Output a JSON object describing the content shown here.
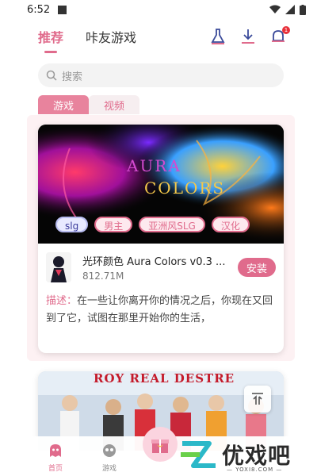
{
  "status": {
    "time": "6:52"
  },
  "topnav": {
    "tabs": [
      {
        "label": "推荐",
        "active": true
      },
      {
        "label": "咔友游戏",
        "active": false
      }
    ],
    "icons": [
      "clean-icon",
      "download-icon",
      "bell-icon"
    ],
    "notification_count": "1"
  },
  "search": {
    "placeholder": "搜索"
  },
  "category_tabs": [
    {
      "label": "游戏",
      "active": true
    },
    {
      "label": "视频",
      "active": false
    }
  ],
  "featured": {
    "banner_text_line1": "AURA",
    "banner_text_line2": "COLORS",
    "tags": [
      "slg",
      "男主",
      "亚洲风SLG",
      "汉化"
    ],
    "title": "光环颜色 Aura Colors v0.3 ...",
    "size": "812.71M",
    "install_label": "安装",
    "desc_label": "描述：",
    "description": "在一些让你离开你的情况之后，你现在又回到了它，试图在那里开始你的生活，"
  },
  "second_card": {
    "title": "ROY REAL DESTRE"
  },
  "bottom_nav": [
    {
      "label": "首页",
      "icon": "ghost-icon",
      "active": true
    },
    {
      "label": "游戏",
      "icon": "gamepad-icon",
      "active": false
    }
  ],
  "watermark": {
    "brand": "优戏吧",
    "url": "— YOXI8.COM —"
  },
  "colors": {
    "accent": "#e06b8c",
    "accent_light": "#fde9ee",
    "tab_active_bg": "#e8839d"
  }
}
